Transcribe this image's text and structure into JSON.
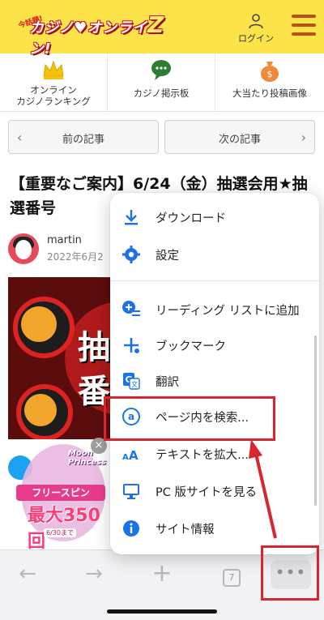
{
  "header": {
    "logo_tag": "今話題!",
    "logo_text": "カジノ♥オンライン!",
    "logo_badge": "Z",
    "login_label": "ログイン",
    "accent_color": "#fde34a",
    "brand_red": "#c8141c"
  },
  "categories": [
    {
      "label": "オンライン\nカジノランキング",
      "icon": "crown-icon"
    },
    {
      "label": "カジノ掲示板",
      "icon": "chat-bubble-icon"
    },
    {
      "label": "大当たり投稿画像",
      "icon": "money-bag-icon"
    }
  ],
  "pager": {
    "prev_label": "前の記事",
    "next_label": "次の記事"
  },
  "article": {
    "title": "【重要なご案内】6/24（金）抽選会用★抽選番号",
    "author": "martin",
    "date": "2022年6月2",
    "hero_text": "抽\n番"
  },
  "promo": {
    "title": "Moon\nPrincess",
    "ribbon": "フリースピン",
    "amount": "最大350回",
    "until": "6/30まで",
    "close": "×"
  },
  "menu": {
    "items": [
      {
        "label": "ダウンロード",
        "icon": "download-icon"
      },
      {
        "label": "設定",
        "icon": "gear-icon"
      },
      {
        "label": "リーディング リストに追加",
        "icon": "reading-list-add-icon"
      },
      {
        "label": "ブックマーク",
        "icon": "bookmark-star-icon"
      },
      {
        "label": "翻訳",
        "icon": "translate-icon"
      },
      {
        "label": "ページ内を検索...",
        "icon": "find-in-page-icon"
      },
      {
        "label": "テキストを拡大...",
        "icon": "text-size-icon"
      },
      {
        "label": "PC 版サイトを見る",
        "icon": "desktop-site-icon"
      },
      {
        "label": "サイト情報",
        "icon": "info-icon"
      }
    ],
    "icon_color": "#1a73e8"
  },
  "toolbar": {
    "tab_count": "7",
    "more_label": "•••"
  }
}
